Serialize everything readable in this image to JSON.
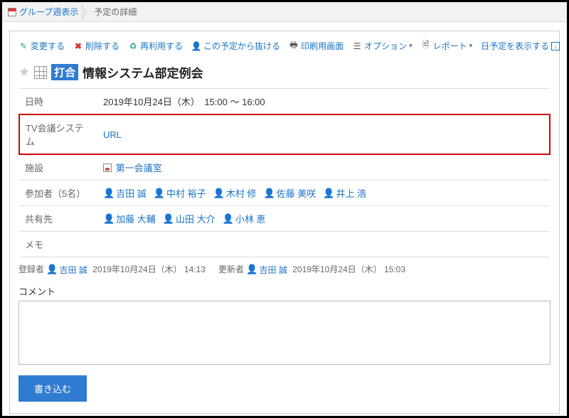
{
  "breadcrumb": {
    "parent": "グループ週表示",
    "current": "予定の詳細"
  },
  "toolbar": {
    "edit": "変更する",
    "delete": "削除する",
    "reuse": "再利用する",
    "leave": "この予定から抜ける",
    "print": "印刷用画面",
    "options": "オプション",
    "report": "レポート",
    "show_day": "日予定を表示する"
  },
  "event": {
    "tag": "打合",
    "title": "情報システム部定例会"
  },
  "rows": {
    "datetime_label": "日時",
    "datetime_value": "2019年10月24日（木）　15:00 〜 16:00",
    "tvconf_label": "TV会議システム",
    "tvconf_link": "URL",
    "facility_label": "施設",
    "facility_value": "第一会議室",
    "attendees_label": "参加者（5名）",
    "attendees": [
      "吉田 誠",
      "中村 裕子",
      "木村 修",
      "佐藤 美咲",
      "井上 浩"
    ],
    "shared_label": "共有先",
    "shared": [
      "加藤 大輔",
      "山田 大介",
      "小林 恵"
    ],
    "memo_label": "メモ"
  },
  "meta": {
    "registrant_label": "登録者",
    "registrant_name": "吉田 誠",
    "registrant_time": "2019年10月24日（木） 14:13",
    "updater_label": "更新者",
    "updater_name": "吉田 誠",
    "updater_time": "2019年10月24日（木） 15:03"
  },
  "comment": {
    "label": "コメント",
    "submit": "書き込む"
  }
}
